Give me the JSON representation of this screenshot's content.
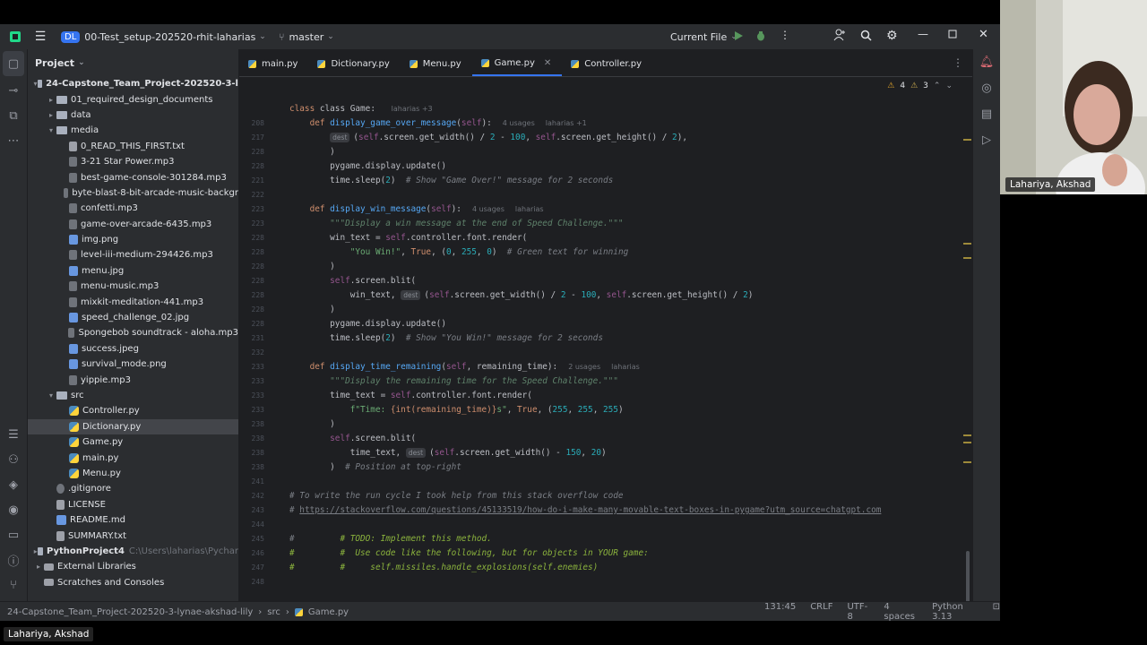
{
  "titlebar": {
    "project_badge": "DL",
    "project_name": "00-Test_setup-202520-rhit-laharias",
    "branch": "master",
    "run_config": "Current File"
  },
  "project_panel": {
    "title": "Project",
    "tree": [
      {
        "indent": 0,
        "arrow": "▾",
        "icon": "folder",
        "label": "24-Capstone_Team_Project-202520-3-l",
        "bold": true
      },
      {
        "indent": 1,
        "arrow": "▸",
        "icon": "folder",
        "label": "01_required_design_documents"
      },
      {
        "indent": 1,
        "arrow": "▸",
        "icon": "folder",
        "label": "data"
      },
      {
        "indent": 1,
        "arrow": "▾",
        "icon": "folder",
        "label": "media"
      },
      {
        "indent": 2,
        "arrow": "",
        "icon": "txt",
        "label": "0_READ_THIS_FIRST.txt"
      },
      {
        "indent": 2,
        "arrow": "",
        "icon": "mp3",
        "label": "3-21 Star Power.mp3"
      },
      {
        "indent": 2,
        "arrow": "",
        "icon": "mp3",
        "label": "best-game-console-301284.mp3"
      },
      {
        "indent": 2,
        "arrow": "",
        "icon": "mp3",
        "label": "byte-blast-8-bit-arcade-music-backgr"
      },
      {
        "indent": 2,
        "arrow": "",
        "icon": "mp3",
        "label": "confetti.mp3"
      },
      {
        "indent": 2,
        "arrow": "",
        "icon": "mp3",
        "label": "game-over-arcade-6435.mp3"
      },
      {
        "indent": 2,
        "arrow": "",
        "icon": "img",
        "label": "img.png"
      },
      {
        "indent": 2,
        "arrow": "",
        "icon": "mp3",
        "label": "level-iii-medium-294426.mp3"
      },
      {
        "indent": 2,
        "arrow": "",
        "icon": "img",
        "label": "menu.jpg"
      },
      {
        "indent": 2,
        "arrow": "",
        "icon": "mp3",
        "label": "menu-music.mp3"
      },
      {
        "indent": 2,
        "arrow": "",
        "icon": "mp3",
        "label": "mixkit-meditation-441.mp3"
      },
      {
        "indent": 2,
        "arrow": "",
        "icon": "img",
        "label": "speed_challenge_02.jpg"
      },
      {
        "indent": 2,
        "arrow": "",
        "icon": "mp3",
        "label": "Spongebob soundtrack - aloha.mp3"
      },
      {
        "indent": 2,
        "arrow": "",
        "icon": "img",
        "label": "success.jpeg"
      },
      {
        "indent": 2,
        "arrow": "",
        "icon": "img",
        "label": "survival_mode.png"
      },
      {
        "indent": 2,
        "arrow": "",
        "icon": "mp3",
        "label": "yippie.mp3"
      },
      {
        "indent": 1,
        "arrow": "▾",
        "icon": "folder",
        "label": "src"
      },
      {
        "indent": 2,
        "arrow": "",
        "icon": "py",
        "label": "Controller.py"
      },
      {
        "indent": 2,
        "arrow": "",
        "icon": "py",
        "label": "Dictionary.py",
        "selected": true
      },
      {
        "indent": 2,
        "arrow": "",
        "icon": "py",
        "label": "Game.py"
      },
      {
        "indent": 2,
        "arrow": "",
        "icon": "py",
        "label": "main.py"
      },
      {
        "indent": 2,
        "arrow": "",
        "icon": "py",
        "label": "Menu.py"
      },
      {
        "indent": 1,
        "arrow": "",
        "icon": "git",
        "label": ".gitignore"
      },
      {
        "indent": 1,
        "arrow": "",
        "icon": "txt",
        "label": "LICENSE"
      },
      {
        "indent": 1,
        "arrow": "",
        "icon": "md",
        "label": "README.md"
      },
      {
        "indent": 1,
        "arrow": "",
        "icon": "txt",
        "label": "SUMMARY.txt"
      },
      {
        "indent": 0,
        "arrow": "▸",
        "icon": "folder",
        "label": "PythonProject4",
        "suffix": "C:\\Users\\laharias\\Pychar",
        "bold": true
      },
      {
        "indent": 0,
        "arrow": "▸",
        "icon": "lib",
        "label": "External Libraries"
      },
      {
        "indent": 0,
        "arrow": "",
        "icon": "lib",
        "label": "Scratches and Consoles"
      }
    ]
  },
  "tabs": [
    {
      "label": "main.py",
      "active": false
    },
    {
      "label": "Dictionary.py",
      "active": false
    },
    {
      "label": "Menu.py",
      "active": false
    },
    {
      "label": "Game.py",
      "active": true
    },
    {
      "label": "Controller.py",
      "active": false
    }
  ],
  "inspection": {
    "warnings": "4",
    "weak": "3"
  },
  "editor": {
    "sticky_header": "class Game:",
    "sticky_author": "laharias +3",
    "line_numbers": [
      "208",
      "217",
      "228",
      "228",
      "221",
      "222",
      "223",
      "223",
      "228",
      "228",
      "228",
      "228",
      "228",
      "228",
      "228",
      "231",
      "232",
      "233",
      "233",
      "233",
      "233",
      "238",
      "238",
      "238",
      "238",
      "241",
      "242",
      "243",
      "244",
      "245",
      "246",
      "247",
      "248"
    ],
    "lines": [
      [
        {
          "t": "    "
        },
        {
          "t": "def ",
          "c": "kw"
        },
        {
          "t": "display_game_over_message",
          "c": "fn"
        },
        {
          "t": "("
        },
        {
          "t": "self",
          "c": "self"
        },
        {
          "t": "):"
        },
        {
          "t": "4 usages",
          "c": "usage"
        },
        {
          "t": "laharias +1",
          "c": "usage"
        }
      ],
      [
        {
          "t": "        "
        },
        {
          "t": "dest",
          "c": "hint"
        },
        {
          "t": "("
        },
        {
          "t": "self",
          "c": "self"
        },
        {
          "t": ".screen.get_width() / "
        },
        {
          "t": "2",
          "c": "num"
        },
        {
          "t": " - "
        },
        {
          "t": "100",
          "c": "num"
        },
        {
          "t": ", "
        },
        {
          "t": "self",
          "c": "self"
        },
        {
          "t": ".screen.get_height() / "
        },
        {
          "t": "2",
          "c": "num"
        },
        {
          "t": "),"
        }
      ],
      [
        {
          "t": "        )"
        }
      ],
      [
        {
          "t": "        pygame.display.update()"
        }
      ],
      [
        {
          "t": "        time.sleep("
        },
        {
          "t": "2",
          "c": "num"
        },
        {
          "t": ")  "
        },
        {
          "t": "# Show \"Game Over!\" message for 2 seconds",
          "c": "cm"
        }
      ],
      [
        {
          "t": ""
        }
      ],
      [
        {
          "t": "    "
        },
        {
          "t": "def ",
          "c": "kw"
        },
        {
          "t": "display_win_message",
          "c": "fn"
        },
        {
          "t": "("
        },
        {
          "t": "self",
          "c": "self"
        },
        {
          "t": "):"
        },
        {
          "t": "4 usages",
          "c": "usage"
        },
        {
          "t": "laharias",
          "c": "usage"
        }
      ],
      [
        {
          "t": "        "
        },
        {
          "t": "\"\"\"Display a win message at the end of Speed Challenge.\"\"\"",
          "c": "doc"
        }
      ],
      [
        {
          "t": "        win_text = "
        },
        {
          "t": "self",
          "c": "self"
        },
        {
          "t": ".controller.font.render("
        }
      ],
      [
        {
          "t": "            "
        },
        {
          "t": "\"You Win!\"",
          "c": "str"
        },
        {
          "t": ", "
        },
        {
          "t": "True",
          "c": "kw"
        },
        {
          "t": ", ("
        },
        {
          "t": "0",
          "c": "num"
        },
        {
          "t": ", "
        },
        {
          "t": "255",
          "c": "num"
        },
        {
          "t": ", "
        },
        {
          "t": "0",
          "c": "num"
        },
        {
          "t": ")  "
        },
        {
          "t": "# Green text for winning",
          "c": "cm"
        }
      ],
      [
        {
          "t": "        )"
        }
      ],
      [
        {
          "t": "        "
        },
        {
          "t": "self",
          "c": "self"
        },
        {
          "t": ".screen.blit("
        }
      ],
      [
        {
          "t": "            win_text, "
        },
        {
          "t": "dest",
          "c": "hint"
        },
        {
          "t": "("
        },
        {
          "t": "self",
          "c": "self"
        },
        {
          "t": ".screen.get_width() / "
        },
        {
          "t": "2",
          "c": "num"
        },
        {
          "t": " - "
        },
        {
          "t": "100",
          "c": "num"
        },
        {
          "t": ", "
        },
        {
          "t": "self",
          "c": "self"
        },
        {
          "t": ".screen.get_height() / "
        },
        {
          "t": "2",
          "c": "num"
        },
        {
          "t": ")"
        }
      ],
      [
        {
          "t": "        )"
        }
      ],
      [
        {
          "t": "        pygame.display.update()"
        }
      ],
      [
        {
          "t": "        time.sleep("
        },
        {
          "t": "2",
          "c": "num"
        },
        {
          "t": ")  "
        },
        {
          "t": "# Show \"You Win!\" message for 2 seconds",
          "c": "cm"
        }
      ],
      [
        {
          "t": ""
        }
      ],
      [
        {
          "t": "    "
        },
        {
          "t": "def ",
          "c": "kw"
        },
        {
          "t": "display_time_remaining",
          "c": "fn"
        },
        {
          "t": "("
        },
        {
          "t": "self",
          "c": "self"
        },
        {
          "t": ", remaining_time):"
        },
        {
          "t": "2 usages",
          "c": "usage"
        },
        {
          "t": "laharias",
          "c": "usage"
        }
      ],
      [
        {
          "t": "        "
        },
        {
          "t": "\"\"\"Display the remaining time for the Speed Challenge.\"\"\"",
          "c": "doc"
        }
      ],
      [
        {
          "t": "        time_text = "
        },
        {
          "t": "self",
          "c": "self"
        },
        {
          "t": ".controller.font.render("
        }
      ],
      [
        {
          "t": "            "
        },
        {
          "t": "f\"Time: ",
          "c": "str"
        },
        {
          "t": "{int(remaining_time)}",
          "c": "kw"
        },
        {
          "t": "s\"",
          "c": "str"
        },
        {
          "t": ", "
        },
        {
          "t": "True",
          "c": "kw"
        },
        {
          "t": ", ("
        },
        {
          "t": "255",
          "c": "num"
        },
        {
          "t": ", "
        },
        {
          "t": "255",
          "c": "num"
        },
        {
          "t": ", "
        },
        {
          "t": "255",
          "c": "num"
        },
        {
          "t": ")"
        }
      ],
      [
        {
          "t": "        )"
        }
      ],
      [
        {
          "t": "        "
        },
        {
          "t": "self",
          "c": "self"
        },
        {
          "t": ".screen.blit("
        }
      ],
      [
        {
          "t": "            time_text, "
        },
        {
          "t": "dest",
          "c": "hint"
        },
        {
          "t": "("
        },
        {
          "t": "self",
          "c": "self"
        },
        {
          "t": ".screen.get_width() - "
        },
        {
          "t": "150",
          "c": "num"
        },
        {
          "t": ", "
        },
        {
          "t": "20",
          "c": "num"
        },
        {
          "t": ")"
        }
      ],
      [
        {
          "t": "        )  "
        },
        {
          "t": "# Position at top-right",
          "c": "cm"
        }
      ],
      [
        {
          "t": ""
        }
      ],
      [
        {
          "t": "# To write the run cycle I took help from this stack overflow code",
          "c": "cm"
        }
      ],
      [
        {
          "t": "# ",
          "c": "cm"
        },
        {
          "t": "https://stackoverflow.com/questions/45133519/how-do-i-make-many-movable-text-boxes-in-pygame?utm_source=chatgpt.com",
          "c": "link"
        }
      ],
      [
        {
          "t": ""
        }
      ],
      [
        {
          "t": "#         ",
          "c": "cm"
        },
        {
          "t": "# TODO: Implement this method.",
          "c": "todo"
        }
      ],
      [
        {
          "t": "#         #  Use code like the following, but for objects in YOUR game:",
          "c": "todo"
        }
      ],
      [
        {
          "t": "#         #     self.missiles.handle_explosions(self.enemies)",
          "c": "todo"
        }
      ],
      [
        {
          "t": ""
        }
      ]
    ]
  },
  "statusbar": {
    "crumb_project": "24-Capstone_Team_Project-202520-3-lynae-akshad-lily",
    "crumb_src": "src",
    "crumb_file": "Game.py",
    "position": "131:45",
    "line_sep": "CRLF",
    "encoding": "UTF-8",
    "indent": "4 spaces",
    "interpreter": "Python 3.13"
  },
  "webcam": {
    "name": "Lahariya, Akshad"
  },
  "bottom_badge": "Lahariya, Akshad"
}
